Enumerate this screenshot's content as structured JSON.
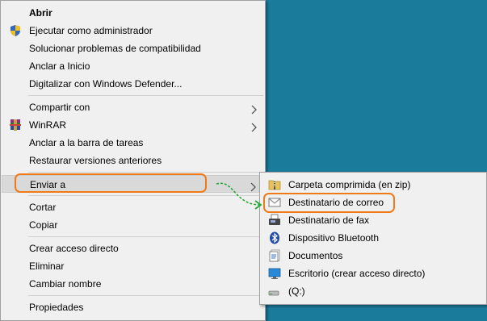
{
  "colors": {
    "desktop": "#1a7b9b",
    "menu_bg": "#f0f0f0",
    "hover": "#d9d9d9",
    "ring": "#f07a1a",
    "arrow": "#22aa33"
  },
  "context_menu": {
    "open": "Abrir",
    "run_as_admin": "Ejecutar como administrador",
    "troubleshoot": "Solucionar problemas de compatibilidad",
    "pin_start": "Anclar a Inicio",
    "scan_defender": "Digitalizar con Windows Defender...",
    "share": "Compartir con",
    "winrar": "WinRAR",
    "pin_taskbar": "Anclar a la barra de tareas",
    "restore": "Restaurar versiones anteriores",
    "send_to": "Enviar a",
    "cut": "Cortar",
    "copy": "Copiar",
    "create_shortcut": "Crear acceso directo",
    "delete": "Eliminar",
    "rename": "Cambiar nombre",
    "properties": "Propiedades"
  },
  "send_to_menu": {
    "zip": "Carpeta comprimida (en zip)",
    "mail": "Destinatario de correo",
    "fax": "Destinatario de fax",
    "bluetooth": "Dispositivo Bluetooth",
    "documents": "Documentos",
    "desktop": "Escritorio (crear acceso directo)",
    "drive": "(Q:)"
  },
  "icons": {
    "shield": "uac-shield-icon",
    "winrar": "winrar-icon",
    "zip": "zip-folder-icon",
    "mail": "mail-recipient-icon",
    "fax": "fax-icon",
    "bluetooth": "bluetooth-icon",
    "documents": "documents-icon",
    "desktop": "desktop-icon",
    "drive": "drive-icon"
  }
}
